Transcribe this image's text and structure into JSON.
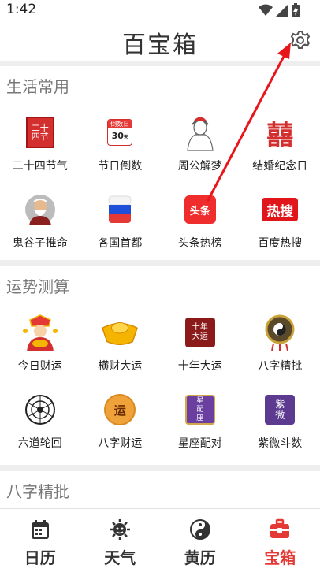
{
  "status": {
    "time": "1:42"
  },
  "header": {
    "title": "百宝箱",
    "settings_icon": "gear-icon"
  },
  "sections": [
    {
      "title": "生活常用",
      "items": [
        {
          "label": "二十四节气",
          "icon": "solar-terms-seal-icon",
          "badge": "二十四节"
        },
        {
          "label": "节日倒数",
          "icon": "countdown-calendar-icon",
          "badge_top": "倒数日",
          "badge_num": "30",
          "badge_unit": "天"
        },
        {
          "label": "周公解梦",
          "icon": "zhougong-portrait-icon"
        },
        {
          "label": "结婚纪念日",
          "icon": "double-happiness-icon",
          "badge": "囍"
        },
        {
          "label": "鬼谷子推命",
          "icon": "guiguzi-portrait-icon"
        },
        {
          "label": "各国首都",
          "icon": "flag-icon"
        },
        {
          "label": "头条热榜",
          "icon": "toutiao-icon",
          "badge": "头条"
        },
        {
          "label": "百度热搜",
          "icon": "baidu-hot-search-icon",
          "badge": "热搜"
        }
      ]
    },
    {
      "title": "运势测算",
      "items": [
        {
          "label": "今日财运",
          "icon": "god-of-wealth-icon"
        },
        {
          "label": "横财大运",
          "icon": "gold-ingot-icon"
        },
        {
          "label": "十年大运",
          "icon": "ten-year-fortune-icon",
          "badge": "十年大运"
        },
        {
          "label": "八字精批",
          "icon": "bagua-icon"
        },
        {
          "label": "六道轮回",
          "icon": "six-paths-icon"
        },
        {
          "label": "八字财运",
          "icon": "bazi-wealth-icon",
          "badge": "运"
        },
        {
          "label": "星座配对",
          "icon": "zodiac-match-icon",
          "badge_top": "星",
          "badge_num": "配",
          "badge_unit": "座"
        },
        {
          "label": "紫微斗数",
          "icon": "ziwei-icon",
          "badge": "紫微"
        }
      ]
    },
    {
      "title": "八字精批",
      "items": []
    }
  ],
  "tabs": [
    {
      "label": "日历",
      "icon": "calendar-icon",
      "active": false
    },
    {
      "label": "天气",
      "icon": "weather-icon",
      "active": false
    },
    {
      "label": "黄历",
      "icon": "yin-yang-icon",
      "active": false
    },
    {
      "label": "宝箱",
      "icon": "treasure-chest-icon",
      "active": true
    }
  ],
  "colors": {
    "accent": "#e53935",
    "tab_text": "#333333",
    "section_title": "#777777",
    "arrow": "#e8161b"
  }
}
